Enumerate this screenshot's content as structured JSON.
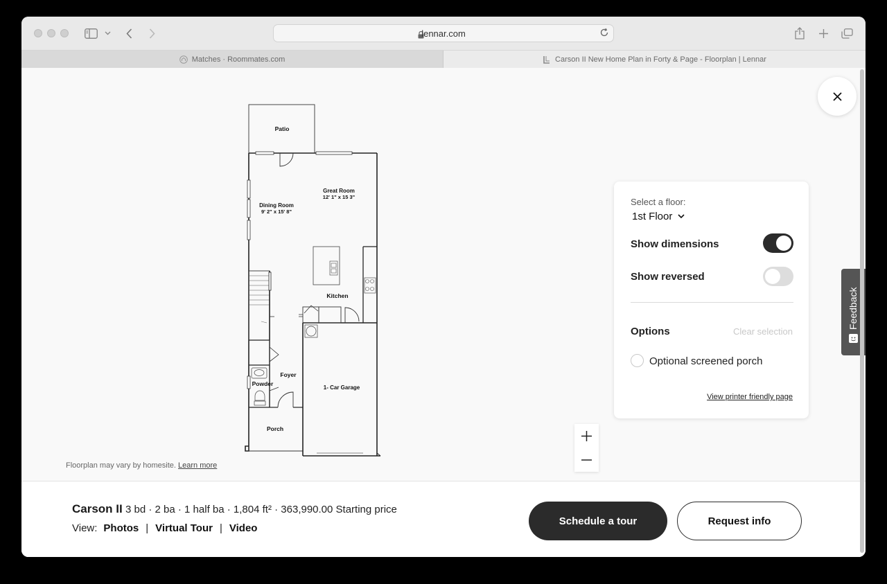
{
  "browser": {
    "url": "lennar.com",
    "tabs": [
      {
        "title": "Matches · Roommates.com",
        "active": false
      },
      {
        "title": "Carson II New Home Plan in Forty & Page - Floorplan | Lennar",
        "active": true
      }
    ]
  },
  "floorplan": {
    "rooms": {
      "patio": "Patio",
      "great_room": "Great Room",
      "great_room_dim": "12' 1\" x 15 3\"",
      "dining_room": "Dining Room",
      "dining_room_dim": "9' 2\" x 15' 8\"",
      "kitchen": "Kitchen",
      "foyer": "Foyer",
      "powder": "Powder",
      "garage": "1- Car Garage",
      "porch": "Porch"
    },
    "disclaimer": "Floorplan may vary by homesite.",
    "learn_more": "Learn more"
  },
  "panel": {
    "select_floor_label": "Select a floor:",
    "selected_floor": "1st Floor",
    "show_dimensions_label": "Show dimensions",
    "show_dimensions_on": true,
    "show_reversed_label": "Show reversed",
    "show_reversed_on": false,
    "options_title": "Options",
    "clear_selection": "Clear selection",
    "option_items": [
      "Optional screened porch"
    ],
    "printer_link": "View printer friendly page"
  },
  "feedback_label": "Feedback",
  "home": {
    "name": "Carson II",
    "specs": "3 bd · 2 ba · 1 half ba · 1,804 ft² · 363,990.00 Starting price",
    "view_label": "View:",
    "view_links": [
      "Photos",
      "Virtual Tour",
      "Video"
    ]
  },
  "actions": {
    "schedule_tour": "Schedule a tour",
    "request_info": "Request info"
  },
  "colors": {
    "dark_button": "#2b2b2b",
    "background": "#f9f9f9"
  }
}
